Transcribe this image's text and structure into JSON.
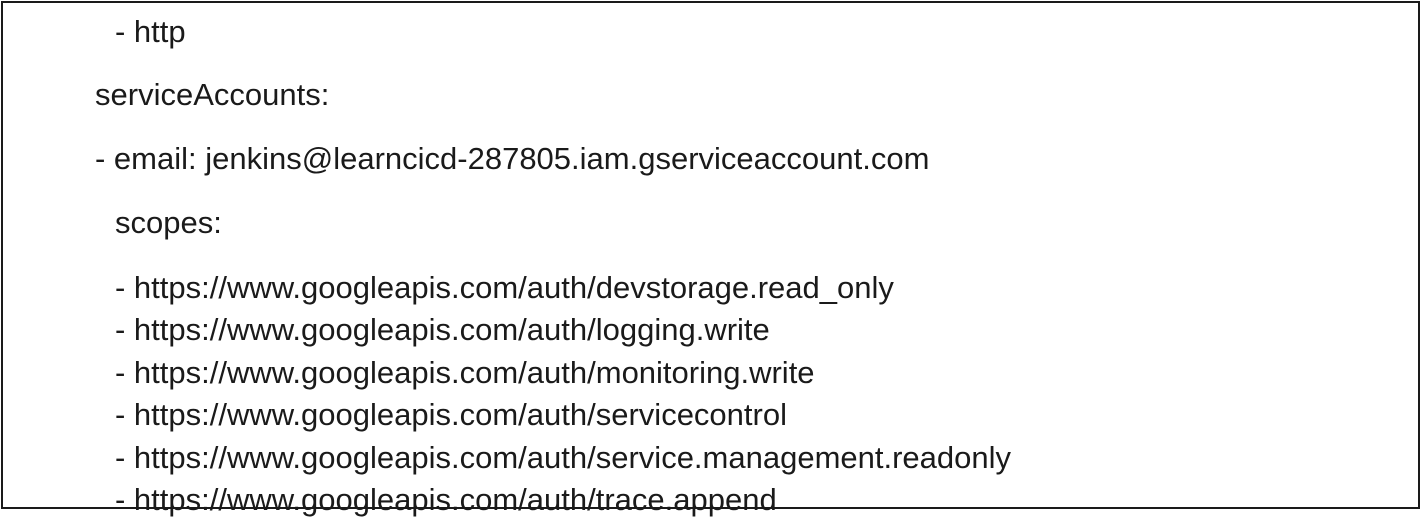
{
  "document": {
    "protocol_item": "- http",
    "service_accounts_key": "serviceAccounts:",
    "email_line": "- email: jenkins@learncicd-287805.iam.gserviceaccount.com",
    "scopes_key": "scopes:",
    "scopes": [
      "- https://www.googleapis.com/auth/devstorage.read_only",
      "- https://www.googleapis.com/auth/logging.write",
      "- https://www.googleapis.com/auth/monitoring.write",
      "- https://www.googleapis.com/auth/servicecontrol",
      "- https://www.googleapis.com/auth/service.management.readonly",
      "- https://www.googleapis.com/auth/trace.append"
    ]
  }
}
